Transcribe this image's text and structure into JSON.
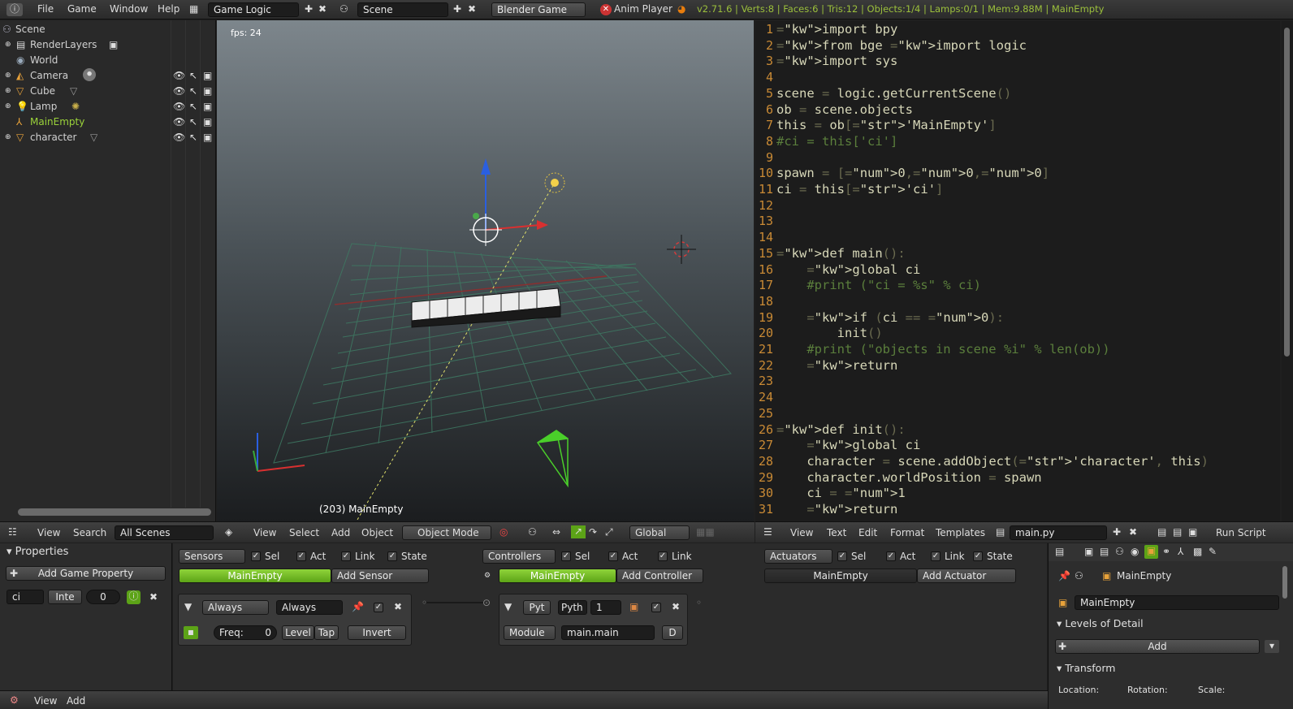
{
  "top": {
    "menus": [
      "File",
      "Game",
      "Window",
      "Help"
    ],
    "layout": "Game Logic",
    "scene": "Scene",
    "engine": "Blender Game",
    "anim": "Anim Player",
    "stats": "v2.71.6 | Verts:8 | Faces:6 | Tris:12 | Objects:1/4 | Lamps:0/1 | Mem:9.88M | MainEmpty"
  },
  "outliner": {
    "items": [
      {
        "label": "Scene"
      },
      {
        "label": "RenderLayers"
      },
      {
        "label": "World"
      },
      {
        "label": "Camera"
      },
      {
        "label": "Cube"
      },
      {
        "label": "Lamp"
      },
      {
        "label": "MainEmpty"
      },
      {
        "label": "character"
      }
    ],
    "menu": [
      "View",
      "Search"
    ],
    "filter": "All Scenes"
  },
  "viewport": {
    "fps": "fps: 24",
    "selected": "(203) MainEmpty",
    "menu": [
      "View",
      "Select",
      "Add",
      "Object"
    ],
    "mode": "Object Mode",
    "orientation": "Global"
  },
  "text_editor": {
    "lines": [
      "import bpy",
      "from bge import logic",
      "import sys",
      "",
      "scene = logic.getCurrentScene()",
      "ob = scene.objects",
      "this = ob['MainEmpty']",
      "#ci = this['ci']",
      "",
      "spawn = [0,0,0]",
      "ci = this['ci']",
      "",
      "",
      "",
      "def main():",
      "    global ci",
      "    #print (\"ci = %s\" % ci)",
      "",
      "    if (ci == 0):",
      "        init()",
      "    #print (\"objects in scene %i\" % len(ob))",
      "    return",
      "",
      "",
      "",
      "def init():",
      "    global ci",
      "    character = scene.addObject('character', this)",
      "    character.worldPosition = spawn",
      "    ci = 1",
      "    return"
    ],
    "menu": [
      "View",
      "Text",
      "Edit",
      "Format",
      "Templates"
    ],
    "file": "main.py",
    "run": "Run Script"
  },
  "properties": {
    "title": "Properties",
    "add_prop": "Add Game Property",
    "prop_name": "ci",
    "prop_type": "Inte",
    "prop_val": "0",
    "menu": [
      "View",
      "Add"
    ]
  },
  "logic": {
    "sensors": "Sensors",
    "controllers": "Controllers",
    "actuators": "Actuators",
    "flags": [
      "Sel",
      "Act",
      "Link",
      "State"
    ],
    "obj": "MainEmpty",
    "add_sensor": "Add Sensor",
    "add_controller": "Add Controller",
    "add_actuator": "Add Actuator",
    "sensor_type": "Always",
    "sensor_name": "Always",
    "freq_label": "Freq:",
    "freq_val": "0",
    "level": "Level",
    "tap": "Tap",
    "invert": "Invert",
    "ctrl_type": "Pyt",
    "ctrl_name": "Pyth",
    "ctrl_prio": "1",
    "module": "Module",
    "module_name": "main.main",
    "d_label": "D"
  },
  "obj_panel": {
    "name": "MainEmpty",
    "datablock": "MainEmpty",
    "lod": "Levels of Detail",
    "add": "Add",
    "transform": "Transform",
    "loc": "Location:",
    "rot": "Rotation:",
    "scale": "Scale:"
  }
}
